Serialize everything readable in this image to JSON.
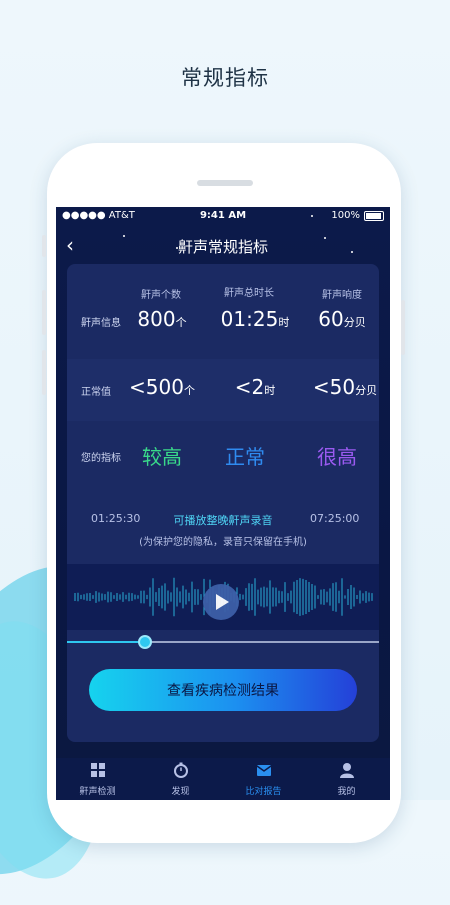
{
  "page_title": "常规指标",
  "status_bar": {
    "carrier": "●●●●● AT&T",
    "time": "9:41 AM",
    "battery": "100%"
  },
  "nav": {
    "title": "鼾声常规指标",
    "back_icon": "chevron-left-icon"
  },
  "metrics": {
    "headers": [
      "鼾声个数",
      "鼾声总时长",
      "鼾声响度"
    ],
    "snore_info_label": "鼾声信息",
    "snore_info": [
      {
        "value": "800",
        "unit": "个"
      },
      {
        "value": "01:25",
        "unit": "时"
      },
      {
        "value": "60",
        "unit": "分贝"
      }
    ],
    "normal_label": "正常值",
    "normal": [
      {
        "value": "<500",
        "unit": "个"
      },
      {
        "value": "<2",
        "unit": "时"
      },
      {
        "value": "<50",
        "unit": "分贝"
      }
    ],
    "indicator_label": "您的指标",
    "indicators": [
      {
        "text": "较高",
        "color": "#39d98a"
      },
      {
        "text": "正常",
        "color": "#2f8bf0"
      },
      {
        "text": "很高",
        "color": "#9a5af0"
      }
    ]
  },
  "recording": {
    "start_time": "01:25:30",
    "end_time": "07:25:00",
    "replay_label": "可播放整晚鼾声录音",
    "privacy_note": "(为保护您的隐私，录音只保留在手机)",
    "progress": 0.25
  },
  "cta_label": "查看疾病检测结果",
  "tabs": [
    {
      "label": "鼾声检测",
      "icon": "grid-icon",
      "active": false
    },
    {
      "label": "发现",
      "icon": "stopwatch-icon",
      "active": false
    },
    {
      "label": "比对报告",
      "icon": "report-icon",
      "active": true
    },
    {
      "label": "我的",
      "icon": "user-icon",
      "active": false
    }
  ],
  "colors": {
    "accent": "#2fc8f0",
    "background": "#0c1a4a",
    "card": "#1b2a63"
  }
}
